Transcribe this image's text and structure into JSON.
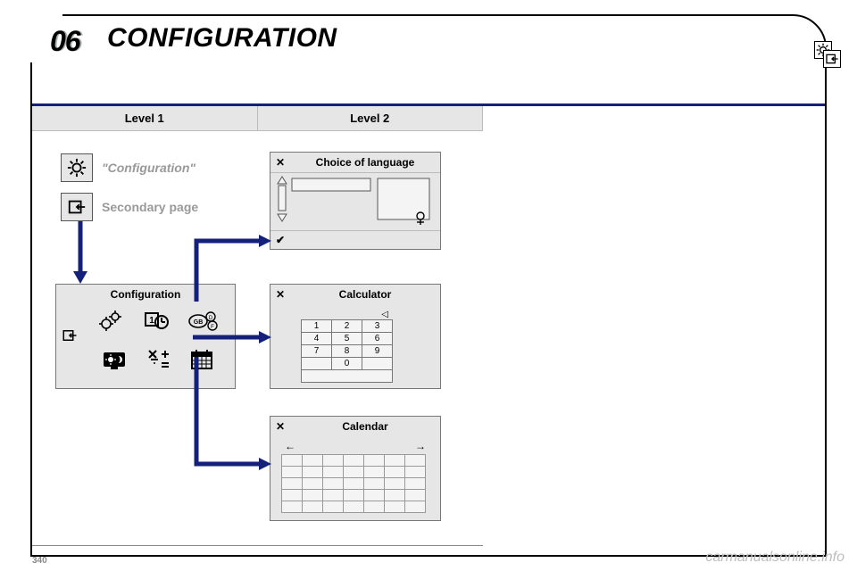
{
  "header": {
    "section_num": "06",
    "title": "CONFIGURATION"
  },
  "levels": {
    "col1": "Level 1",
    "col2": "Level 2"
  },
  "sidebar": {
    "config_label": "\"Configuration\"",
    "secondary_label": "Secondary page"
  },
  "config_panel": {
    "title": "Configuration"
  },
  "language_panel": {
    "close": "✕",
    "title": "Choice of language",
    "confirm": "✔"
  },
  "calc_panel": {
    "close": "✕",
    "title": "Calculator",
    "backspace": "◁",
    "keys": [
      [
        "1",
        "2",
        "3"
      ],
      [
        "4",
        "5",
        "6"
      ],
      [
        "7",
        "8",
        "9"
      ],
      [
        "",
        "0",
        ""
      ]
    ]
  },
  "cal_panel": {
    "close": "✕",
    "title": "Calendar",
    "prev": "←",
    "next": "→"
  },
  "footer": {
    "page": "340",
    "watermark": "carmanualsonline.info"
  }
}
